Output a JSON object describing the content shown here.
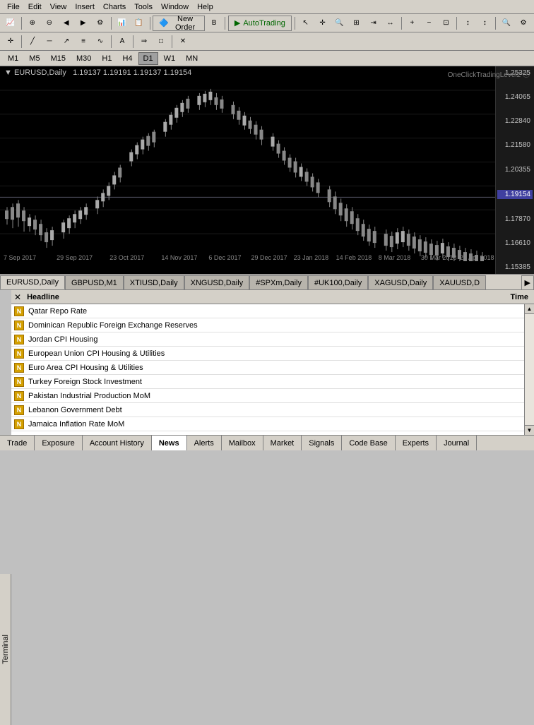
{
  "menubar": {
    "items": [
      "File",
      "Edit",
      "View",
      "Insert",
      "Charts",
      "Tools",
      "Window",
      "Help"
    ]
  },
  "chart": {
    "symbol": "EURUSD",
    "timeframe": "Daily",
    "prices": "1.19137  1.19191  1.19137  1.19154",
    "corner_label": "OneClickTradingLevel2",
    "price_levels": [
      "1.25325",
      "1.24065",
      "1.22840",
      "1.21580",
      "1.20355",
      "1.19154",
      "1.17870",
      "1.16610",
      "1.15385"
    ],
    "time_labels": [
      "7 Sep 2017",
      "29 Sep 2017",
      "23 Oct 2017",
      "14 Nov 2017",
      "6 Dec 2017",
      "29 Dec 2017",
      "23 Jan 2018",
      "14 Feb 2018",
      "8 Mar 2018",
      "30 Mar 2018",
      "23 Apr 2018"
    ]
  },
  "timeframes": {
    "buttons": [
      "M1",
      "M5",
      "M15",
      "M30",
      "H1",
      "H4",
      "D1",
      "W1",
      "MN"
    ],
    "active": "D1"
  },
  "chart_tabs": {
    "tabs": [
      "EURUSD,Daily",
      "GBPUSD,M1",
      "XTIUSD,Daily",
      "XNGUSD,Daily",
      "#SPXm,Daily",
      "#UK100,Daily",
      "XAGUSD,Daily",
      "XAUUSD,D"
    ]
  },
  "news": {
    "headline_label": "Headline",
    "time_label": "Time",
    "items": [
      "Qatar Repo Rate",
      "Dominican Republic Foreign Exchange Reserves",
      "Jordan CPI Housing",
      "European Union CPI Housing & Utilities",
      "Euro Area CPI Housing & Utilities",
      "Turkey Foreign Stock Investment",
      "Pakistan Industrial Production MoM",
      "Lebanon Government Debt",
      "Jamaica Inflation Rate MoM"
    ]
  },
  "bottom_tabs": {
    "items": [
      "Trade",
      "Exposure",
      "Account History",
      "News",
      "Alerts",
      "Mailbox",
      "Market",
      "Signals",
      "Code Base",
      "Experts",
      "Journal"
    ],
    "active": "News"
  },
  "terminal": {
    "label": "Terminal"
  },
  "new_order_btn": "New Order",
  "autotrading_btn": "AutoTrading"
}
